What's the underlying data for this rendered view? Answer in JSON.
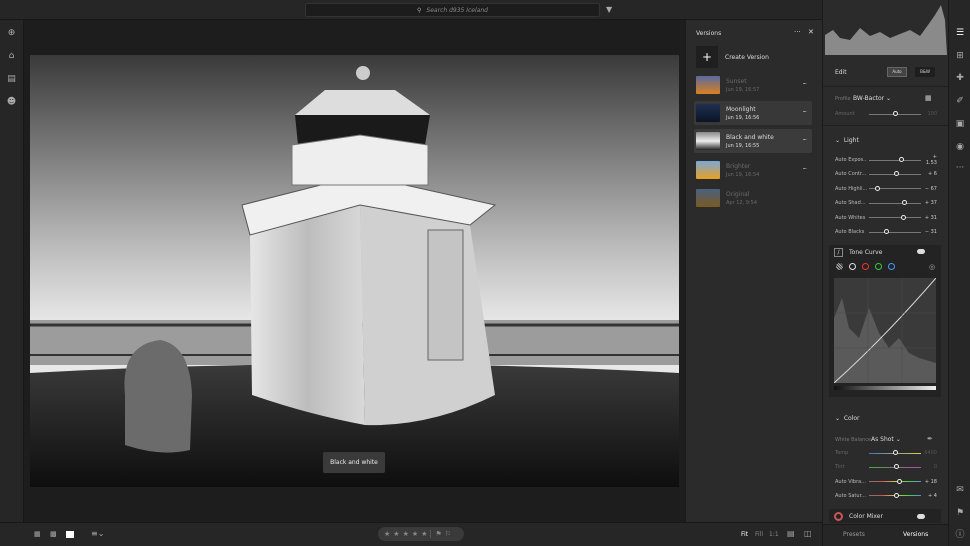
{
  "topbar": {
    "search_placeholder": "Search d935 Iceland"
  },
  "photo": {
    "tooltip": "Black and white"
  },
  "versions": {
    "title": "Versions",
    "create_label": "Create Version",
    "items": [
      {
        "name": "Sunset",
        "date": "Jun 19, 16:57",
        "active": false
      },
      {
        "name": "Moonlight",
        "date": "Jun 19, 16:56",
        "active": true
      },
      {
        "name": "Black and white",
        "date": "Jun 19, 16:55",
        "active": true
      },
      {
        "name": "Brighter",
        "date": "Jun 19, 16:54",
        "active": false
      },
      {
        "name": "Original",
        "date": "Apr 12, 9:54",
        "active": false
      }
    ]
  },
  "edit": {
    "title": "Edit",
    "auto_label": "Auto",
    "raw_label": "B&W",
    "profile_label": "Profile",
    "profile_value": "BW-Bactor",
    "amount_label": "Amount",
    "amount_value": "100",
    "amount": 0.5,
    "light": {
      "title": "Light",
      "sliders": [
        {
          "label": "Auto Expos...",
          "value": "+ 1.53",
          "pos": 0.62
        },
        {
          "label": "Auto Contr...",
          "value": "+ 6",
          "pos": 0.53
        },
        {
          "label": "Auto Highli...",
          "value": "− 67",
          "pos": 0.17
        },
        {
          "label": "Auto Shad...",
          "value": "+ 37",
          "pos": 0.69
        },
        {
          "label": "Auto Whites",
          "value": "+ 31",
          "pos": 0.66
        },
        {
          "label": "Auto Blacks",
          "value": "− 31",
          "pos": 0.34
        }
      ]
    },
    "tone_curve": {
      "title": "Tone Curve"
    },
    "color": {
      "title": "Color",
      "wb_label": "White Balance",
      "wb_value": "As Shot",
      "sliders": [
        {
          "label": "Temp",
          "value": "6400",
          "pos": 0.5,
          "dim": true
        },
        {
          "label": "Tint",
          "value": "0",
          "pos": 0.53,
          "dim": true
        },
        {
          "label": "Auto Vibra...",
          "value": "+ 18",
          "pos": 0.59,
          "dim": false
        },
        {
          "label": "Auto Satur...",
          "value": "+ 4",
          "pos": 0.52,
          "dim": false
        }
      ]
    },
    "color_mixer": {
      "title": "Color Mixer"
    }
  },
  "bottom": {
    "zoom_fit": "Fit",
    "zoom_fill": "Fill",
    "zoom_1to1": "1:1",
    "tab_presets": "Presets",
    "tab_versions": "Versions",
    "rating": 0
  }
}
